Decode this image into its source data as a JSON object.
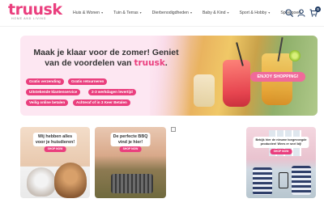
{
  "header": {
    "logo_text": "truusk",
    "logo_tagline": "HOME AND LIVING",
    "nav": [
      {
        "label": "Huis & Wonen"
      },
      {
        "label": "Tuin & Terras"
      },
      {
        "label": "Dierbenodigdheden"
      },
      {
        "label": "Baby & Kind"
      },
      {
        "label": "Sport & Hobby"
      },
      {
        "label": "Speelgoed"
      }
    ],
    "cart_count": "0"
  },
  "hero": {
    "title_line1": "Maak je klaar voor de zomer! Geniet",
    "title_line2": "van de voordelen van ",
    "brand": "truusk",
    "cta_label": "ENJOY SHOPPING!",
    "benefits": [
      "Gratis verzending",
      "Gratis retourneren",
      "Uitstekende klantenservice",
      "2-3 werkdagen levertijd",
      "Veilig online betalen",
      "Achteraf of in 3 Keer Betalen"
    ]
  },
  "cards": [
    {
      "title_line1": "Wij hebben alles",
      "title_line2": "voor je huisdieren!",
      "button": "SHOP NOW"
    },
    {
      "title_line1": "De perfecte BBQ",
      "title_line2": "vind je hier!",
      "button": "SHOP NOW"
    },
    {
      "title_line1": "Bekijk hier de nieuwe toegevoegde",
      "title_line2": "producten! Wees er snel bij!",
      "button": "SHOP NOW"
    }
  ],
  "colors": {
    "brand_pink": "#ea3f7e",
    "hero_bg": "#fde7f2",
    "cart_badge": "#1f3b63"
  },
  "icons": [
    "search-icon",
    "user-icon",
    "cart-icon",
    "chevron-down-icon"
  ]
}
